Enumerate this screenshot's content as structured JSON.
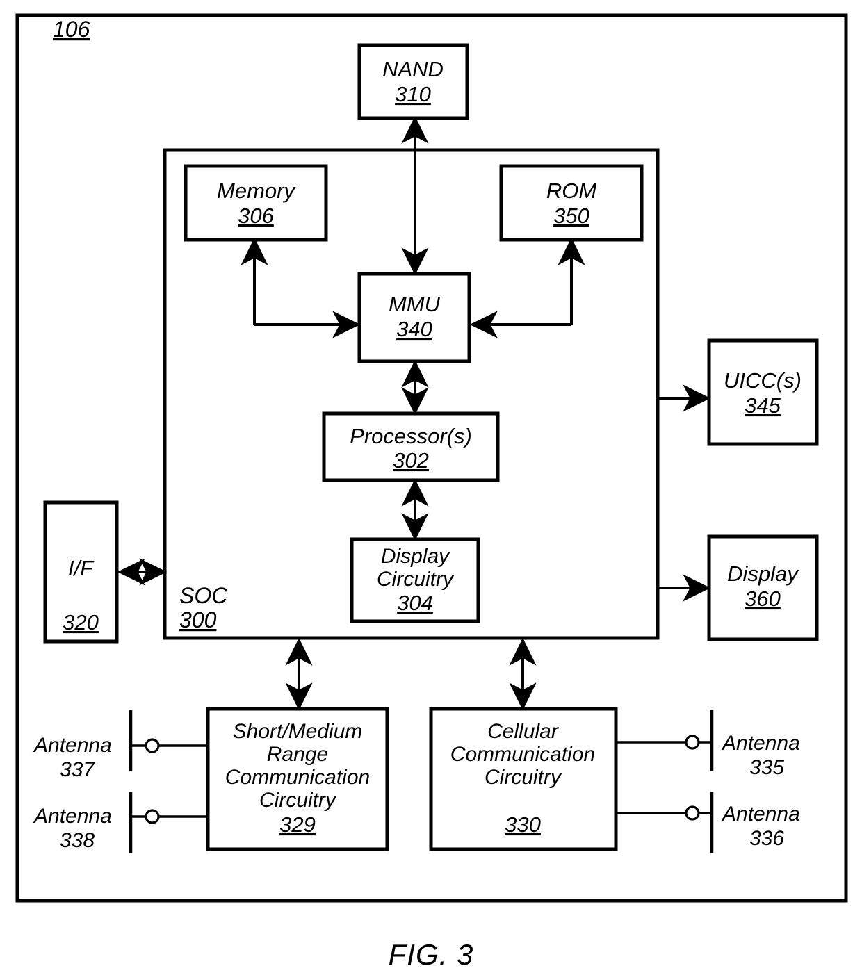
{
  "figure": {
    "caption": "FIG. 3",
    "outer_ref": "106",
    "line_color": "#000000",
    "background": "#ffffff"
  },
  "blocks": {
    "nand": {
      "title": "NAND",
      "ref": "310"
    },
    "memory": {
      "title": "Memory",
      "ref": "306"
    },
    "rom": {
      "title": "ROM",
      "ref": "350"
    },
    "mmu": {
      "title": "MMU",
      "ref": "340"
    },
    "processor": {
      "title": "Processor(s)",
      "ref": "302"
    },
    "display_circuitry": {
      "line1": "Display",
      "line2": "Circuitry",
      "ref": "304"
    },
    "soc": {
      "title": "SOC",
      "ref": "300"
    },
    "interface": {
      "title": "I/F",
      "ref": "320"
    },
    "uicc": {
      "title": "UICC(s)",
      "ref": "345"
    },
    "display": {
      "title": "Display",
      "ref": "360"
    },
    "short_medium_range": {
      "line1": "Short/Medium",
      "line2": "Range",
      "line3": "Communication",
      "line4": "Circuitry",
      "ref": "329"
    },
    "cellular": {
      "line1": "Cellular",
      "line2": "Communication",
      "line3": "Circuitry",
      "ref": "330"
    }
  },
  "antennas": [
    {
      "name": "Antenna",
      "ref": "337",
      "side": "left"
    },
    {
      "name": "Antenna",
      "ref": "338",
      "side": "left"
    },
    {
      "name": "Antenna",
      "ref": "335",
      "side": "right"
    },
    {
      "name": "Antenna",
      "ref": "336",
      "side": "right"
    }
  ]
}
